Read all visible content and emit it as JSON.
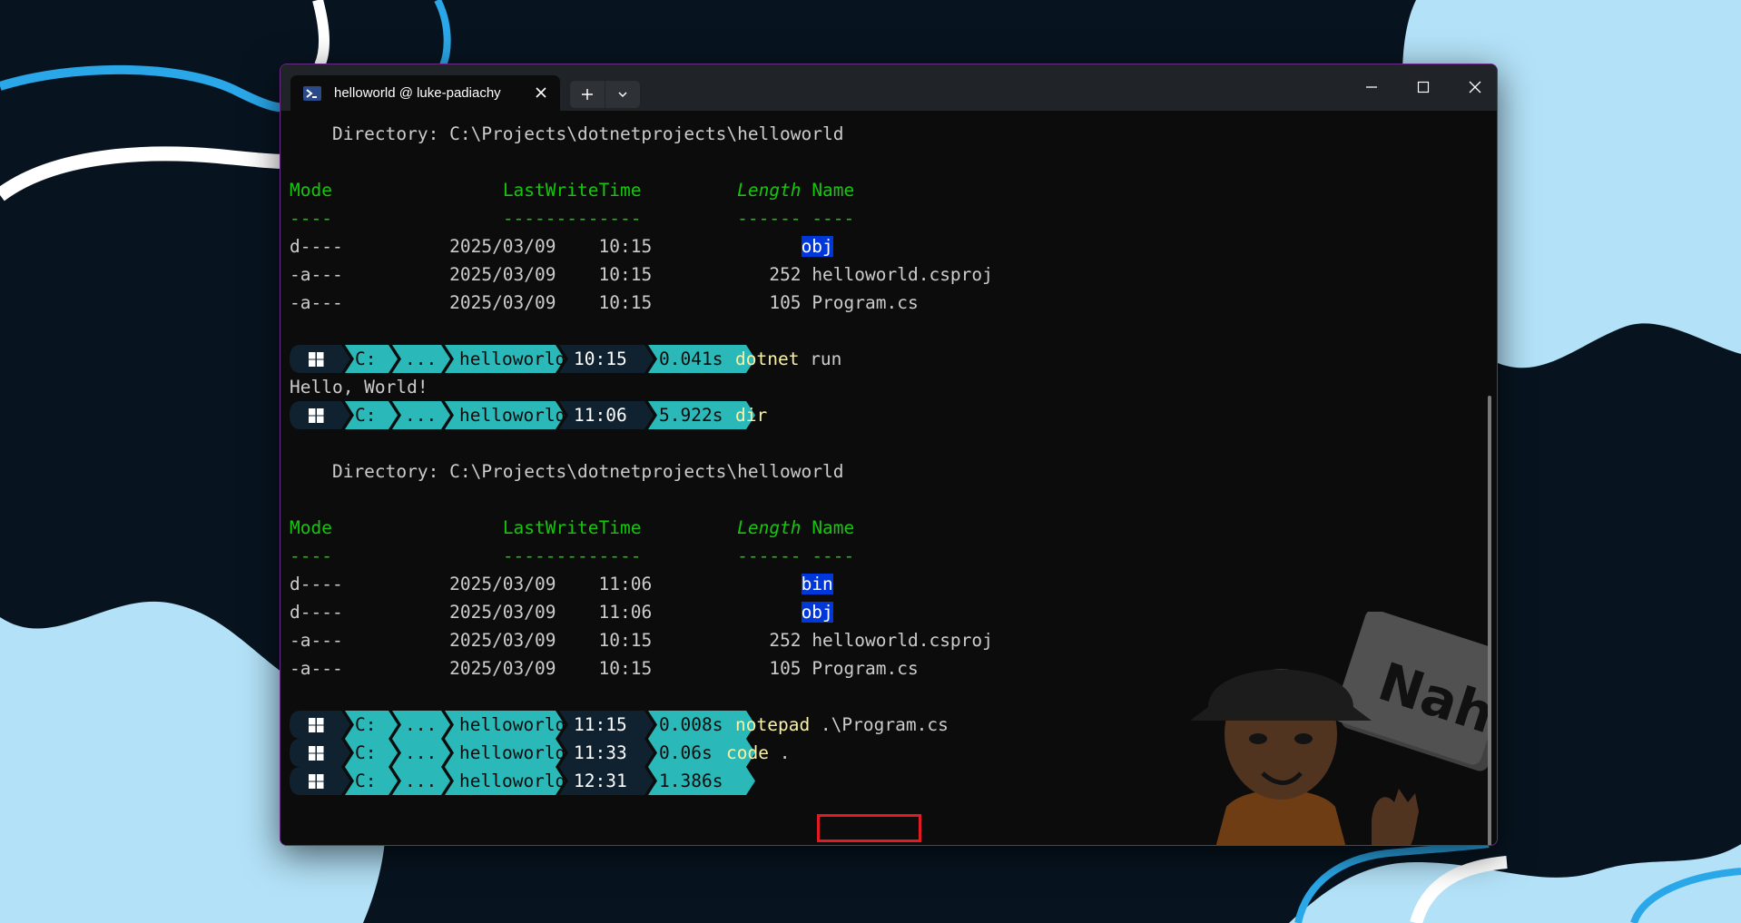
{
  "window": {
    "tab_title": "helloworld @ luke-padiachy",
    "tab_icon": "powershell-icon",
    "controls": [
      "close-tab-icon",
      "plus-icon",
      "chevron-down-icon",
      "minimize-icon",
      "maximize-icon",
      "close-icon"
    ]
  },
  "listing1": {
    "directory": "    Directory: C:\\Projects\\dotnetprojects\\helloworld",
    "header": {
      "mode": "Mode",
      "lastwrite": "LastWriteTime",
      "length": "Length",
      "name": "Name"
    },
    "rule": {
      "mode": "----",
      "lastwrite": "-------------",
      "length": "------",
      "name": "----"
    },
    "rows": [
      {
        "mode": "d----",
        "date": "2025/03/09",
        "time": "10:15",
        "length": "",
        "name": "obj",
        "is_dir": true
      },
      {
        "mode": "-a---",
        "date": "2025/03/09",
        "time": "10:15",
        "length": "252",
        "name": "helloworld.csproj",
        "is_dir": false
      },
      {
        "mode": "-a---",
        "date": "2025/03/09",
        "time": "10:15",
        "length": "105",
        "name": "Program.cs",
        "is_dir": false
      }
    ]
  },
  "prompts": [
    {
      "drive": "C:",
      "ellipsis": "...",
      "folder": "helloworld",
      "time": "10:15",
      "duration": "0.041s",
      "command": "dotnet",
      "args": " run"
    },
    {
      "drive": "C:",
      "ellipsis": "...",
      "folder": "helloworld",
      "time": "11:06",
      "duration": "5.922s",
      "command": "dir",
      "args": ""
    },
    {
      "drive": "C:",
      "ellipsis": "...",
      "folder": "helloworld",
      "time": "11:15",
      "duration": "0.008s",
      "command": "notepad",
      "args": " .\\Program.cs"
    },
    {
      "drive": "C:",
      "ellipsis": "...",
      "folder": "helloworld",
      "time": "11:33",
      "duration": "0.06s",
      "command": "code",
      "args": " ."
    },
    {
      "drive": "C:",
      "ellipsis": "...",
      "folder": "helloworld",
      "time": "12:31",
      "duration": "1.386s",
      "command": "",
      "args": ""
    }
  ],
  "output_hello": "Hello, World!",
  "listing2": {
    "directory": "    Directory: C:\\Projects\\dotnetprojects\\helloworld",
    "header": {
      "mode": "Mode",
      "lastwrite": "LastWriteTime",
      "length": "Length",
      "name": "Name"
    },
    "rule": {
      "mode": "----",
      "lastwrite": "-------------",
      "length": "------",
      "name": "----"
    },
    "rows": [
      {
        "mode": "d----",
        "date": "2025/03/09",
        "time": "11:06",
        "length": "",
        "name": "bin",
        "is_dir": true
      },
      {
        "mode": "d----",
        "date": "2025/03/09",
        "time": "11:06",
        "length": "",
        "name": "obj",
        "is_dir": true
      },
      {
        "mode": "-a---",
        "date": "2025/03/09",
        "time": "10:15",
        "length": "252",
        "name": "helloworld.csproj",
        "is_dir": false
      },
      {
        "mode": "-a---",
        "date": "2025/03/09",
        "time": "10:15",
        "length": "105",
        "name": "Program.cs",
        "is_dir": false
      }
    ]
  },
  "sign_text": "Nah.",
  "colors": {
    "background": "#071420",
    "background_blob": "#b3e1f7",
    "accent_line": "#2aa7e8",
    "prompt_teal": "#2ab9b8",
    "prompt_dark": "#102230",
    "highlight_box": "#e01b24"
  }
}
